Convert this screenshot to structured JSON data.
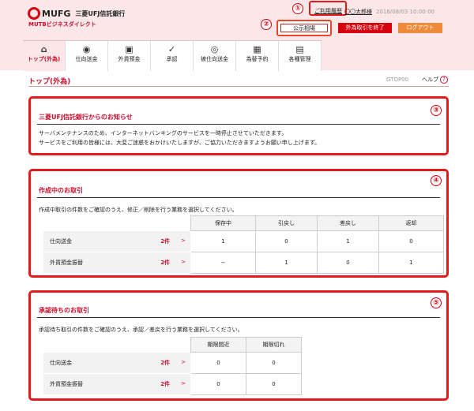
{
  "header": {
    "brand": "MUFG",
    "bank": "三菱UFJ信託銀行",
    "sub": "MUTBビジネスダイレクト",
    "guide": "ご利用履歴",
    "user": "〇〇太郎様",
    "datetime": "2016/08/03 10:00:00",
    "rate": "公示相場",
    "end_btn": "外為取引を終了",
    "logout": "ログアウト"
  },
  "markers": [
    "①",
    "②",
    "③",
    "④",
    "⑤"
  ],
  "nav": [
    {
      "label": "トップ(外為)",
      "icon": "⌂"
    },
    {
      "label": "仕向送金",
      "icon": "◉"
    },
    {
      "label": "外貨預金",
      "icon": "▣"
    },
    {
      "label": "承認",
      "icon": "✓"
    },
    {
      "label": "被仕向送金",
      "icon": "◎"
    },
    {
      "label": "為替予約",
      "icon": "▦"
    },
    {
      "label": "各種管理",
      "icon": "▤"
    }
  ],
  "page": {
    "title": "トップ(外為)",
    "id": "GTOP00",
    "help": "ヘルプ",
    "help_icon": "?"
  },
  "notice": {
    "title": "三菱UFJ信託銀行からのお知らせ",
    "line1": "サーバメンテナンスのため、インターネットバンキングのサービスを一時停止させていただきます。",
    "line2": "サービスをご利用の皆様には、大変ご迷惑をおかけいたしますが、ご協力いただきますようお願い申し上げます。"
  },
  "pending": {
    "title": "作成中のお取引",
    "desc": "作成中取引の件数をご確認のうえ、修正／削除を行う業務を選択してください。",
    "headers": [
      "保存中",
      "引戻し",
      "差戻し",
      "返却"
    ],
    "rows": [
      {
        "label": "仕向送金",
        "count": "2件",
        "cells": [
          "1",
          "0",
          "1",
          "0"
        ]
      },
      {
        "label": "外貨預金振替",
        "count": "2件",
        "cells": [
          "−",
          "1",
          "0",
          "1"
        ]
      }
    ]
  },
  "approval": {
    "title": "承認待ちのお取引",
    "desc": "承認待ち取引の件数をご確認のうえ、承認／差戻を行う業務を選択してください。",
    "headers": [
      "期限間近",
      "期限切れ"
    ],
    "rows": [
      {
        "label": "仕向送金",
        "count": "2件",
        "cells": [
          "0",
          "0"
        ]
      },
      {
        "label": "外貨預金振替",
        "count": "2件",
        "cells": [
          "0",
          "0"
        ]
      }
    ]
  }
}
